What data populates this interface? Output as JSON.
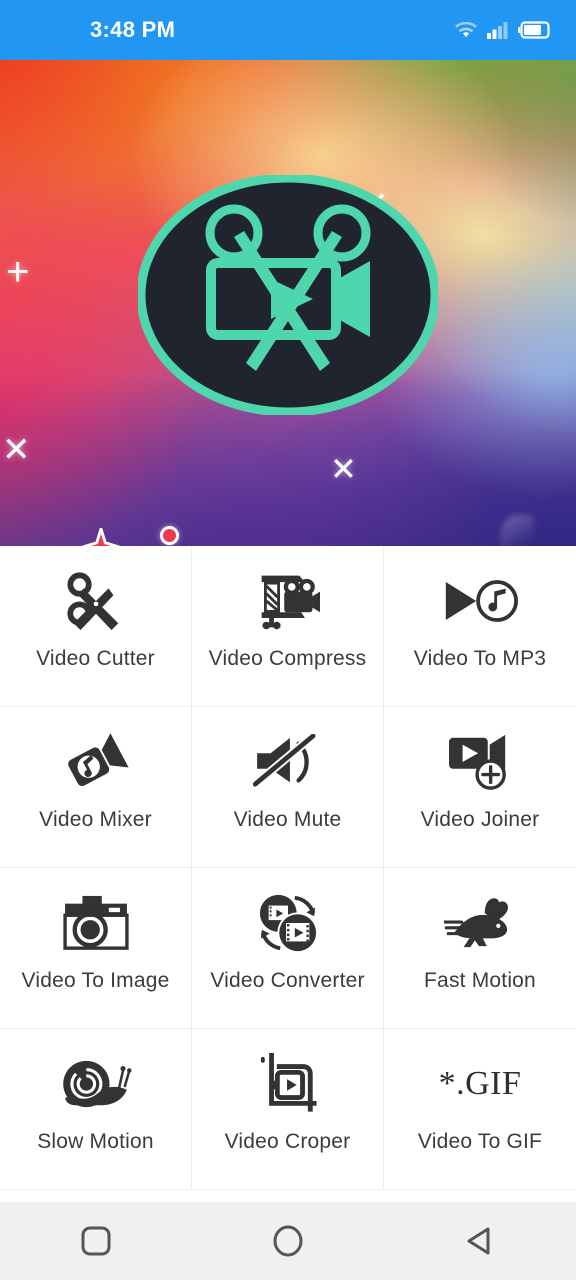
{
  "status_bar": {
    "time": "3:48 PM",
    "background_color": "#2196f3",
    "icons": [
      "wifi-icon",
      "cellular-signal-icon",
      "battery-icon"
    ],
    "battery_level_percent": 70
  },
  "hero": {
    "logo_name": "video-editor-app-logo",
    "logo_description": "Dark ellipse with teal scissors and movie camera with play button",
    "logo_accent_color": "#4ed6ac",
    "logo_body_color": "#20242e",
    "gradient_colors": [
      "#ed2d1f",
      "#f07a22",
      "#5fb63f",
      "#f0e0a0",
      "#79c6ea",
      "#e8306e",
      "#362a86"
    ],
    "decorations": [
      {
        "name": "plus-sparkle",
        "glyph": "+"
      },
      {
        "name": "cross-sparkle-top",
        "glyph": "✕"
      },
      {
        "name": "cross-sparkle-left",
        "glyph": "✕"
      },
      {
        "name": "cross-sparkle-bottom",
        "glyph": "✕"
      },
      {
        "name": "four-point-star-sparkle"
      },
      {
        "name": "red-ring-dot"
      }
    ]
  },
  "tool_grid": {
    "columns": 3,
    "items": [
      {
        "label": "Video Cutter",
        "icon": "scissors-icon"
      },
      {
        "label": "Video Compress",
        "icon": "video-compress-icon"
      },
      {
        "label": "Video To MP3",
        "icon": "play-music-note-icon"
      },
      {
        "label": "Video Mixer",
        "icon": "video-music-mixer-icon"
      },
      {
        "label": "Video Mute",
        "icon": "speaker-mute-icon"
      },
      {
        "label": "Video Joiner",
        "icon": "video-camera-plus-icon"
      },
      {
        "label": "Video To Image",
        "icon": "photo-camera-icon"
      },
      {
        "label": "Video Converter",
        "icon": "convert-circles-icon"
      },
      {
        "label": "Fast Motion",
        "icon": "rabbit-icon"
      },
      {
        "label": "Slow Motion",
        "icon": "snail-icon"
      },
      {
        "label": "Video Croper",
        "icon": "crop-play-icon"
      },
      {
        "label": "Video To GIF",
        "icon": "gif-text-icon",
        "icon_text": "*.GIF"
      }
    ]
  },
  "nav_bar": {
    "background_color": "#f0f0f0",
    "buttons": [
      {
        "name": "recents-button",
        "icon": "square-icon"
      },
      {
        "name": "home-button",
        "icon": "circle-icon"
      },
      {
        "name": "back-button",
        "icon": "triangle-left-icon"
      }
    ]
  }
}
